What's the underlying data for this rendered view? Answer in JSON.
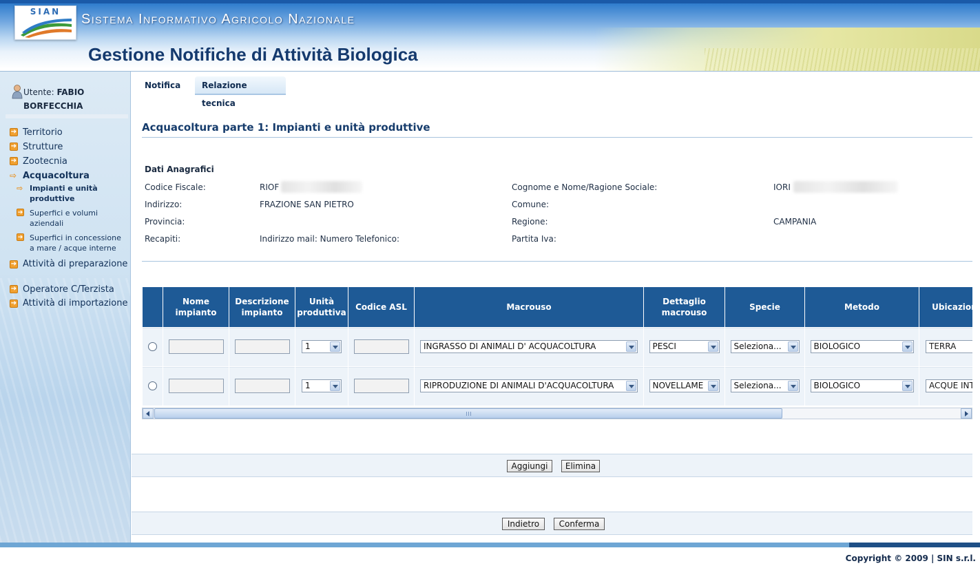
{
  "header": {
    "logo_text": "SIAN",
    "system_title": "Sistema Informativo Agricolo Nazionale",
    "app_title": "Gestione Notifiche di Attività Biologica"
  },
  "sidebar": {
    "user_prefix": "Utente:",
    "user_name": "FABIO BORFECCHIA",
    "menu": [
      {
        "label": "Territorio"
      },
      {
        "label": "Strutture"
      },
      {
        "label": "Zootecnia"
      },
      {
        "label": "Acquacoltura"
      },
      {
        "label": "Attività di preparazione"
      },
      {
        "label": "Operatore C/Terzista"
      },
      {
        "label": "Attività di importazione"
      }
    ],
    "submenu": [
      {
        "label": "Impianti e unità produttive"
      },
      {
        "label": "Superfici e volumi aziendali"
      },
      {
        "label": "Superfici in concessione a mare / acque interne"
      }
    ]
  },
  "tabs": {
    "notifica": "Notifica",
    "relazione": "Relazione tecnica"
  },
  "main": {
    "heading": "Acquacoltura parte 1: Impianti e unità produttive",
    "section_title": "Dati Anagrafici",
    "fields": {
      "codice_fiscale_label": "Codice Fiscale:",
      "codice_fiscale_value": "RIOF",
      "cognome_label": "Cognome e Nome/Ragione Sociale:",
      "cognome_value": "IORI",
      "indirizzo_label": "Indirizzo:",
      "indirizzo_value": "FRAZIONE SAN PIETRO",
      "comune_label": "Comune:",
      "provincia_label": "Provincia:",
      "regione_label": "Regione:",
      "regione_value": "CAMPANIA",
      "recapiti_label": "Recapiti:",
      "recapiti_value": "Indirizzo mail: Numero Telefonico:",
      "partita_iva_label": "Partita Iva:"
    }
  },
  "table": {
    "headers": {
      "nome": "Nome impianto",
      "descrizione": "Descrizione impianto",
      "unita": "Unità produttiva",
      "asl": "Codice ASL",
      "macrouso": "Macrouso",
      "dettaglio": "Dettaglio macrouso",
      "specie": "Specie",
      "metodo": "Metodo",
      "ubicazione": "Ubicazione"
    },
    "rows": [
      {
        "unita": "1",
        "macrouso": "INGRASSO DI ANIMALI D' ACQUACOLTURA",
        "dettaglio": "PESCI",
        "specie": "Seleziona...",
        "metodo": "BIOLOGICO",
        "ubicazione": "TERRA"
      },
      {
        "unita": "1",
        "macrouso": "RIPRODUZIONE DI ANIMALI D'ACQUACOLTURA",
        "dettaglio": "NOVELLAME",
        "specie": "Seleziona...",
        "metodo": "BIOLOGICO",
        "ubicazione": "ACQUE INT"
      }
    ]
  },
  "buttons": {
    "aggiungi": "Aggiungi",
    "elimina": "Elimina",
    "indietro": "Indietro",
    "conferma": "Conferma"
  },
  "footer": {
    "copyright": "Copyright © 2009 | SIN s.r.l."
  },
  "colors": {
    "header_blue": "#1f67b9",
    "table_header": "#1e5a96",
    "title_text": "#153a6e",
    "bullet_orange": "#f0a030"
  }
}
